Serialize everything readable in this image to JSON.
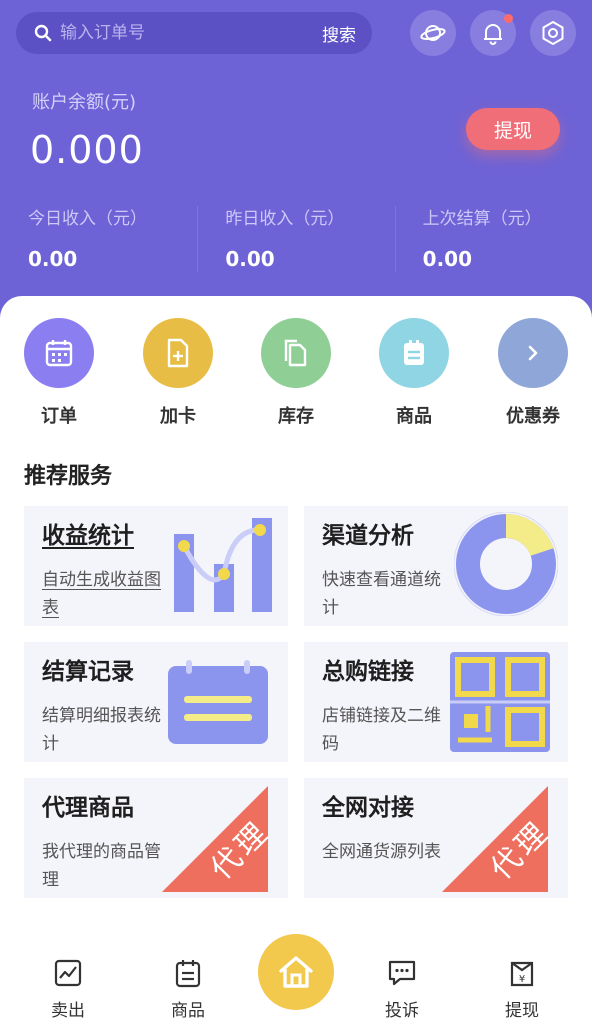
{
  "search": {
    "placeholder": "输入订单号",
    "button": "搜索"
  },
  "balance": {
    "label": "账户余额(元)",
    "value": "0.000",
    "withdraw": "提现"
  },
  "stats": [
    {
      "label": "今日收入（元）",
      "value": "0.00"
    },
    {
      "label": "昨日收入（元）",
      "value": "0.00"
    },
    {
      "label": "上次结算（元）",
      "value": "0.00"
    }
  ],
  "quick": [
    {
      "label": "订单",
      "color": "#8b7ef0",
      "icon": "calendar-icon"
    },
    {
      "label": "加卡",
      "color": "#e7bd45",
      "icon": "add-file-icon"
    },
    {
      "label": "库存",
      "color": "#8fcf96",
      "icon": "copy-icon"
    },
    {
      "label": "商品",
      "color": "#8fd5e3",
      "icon": "list-icon"
    },
    {
      "label": "优惠券",
      "color": "#8fa6d8",
      "icon": "chevron-right-icon"
    }
  ],
  "section": {
    "title": "推荐服务"
  },
  "tiles": [
    {
      "title": "收益统计",
      "desc": "自动生成收益图表",
      "art": "bar-chart-art"
    },
    {
      "title": "渠道分析",
      "desc": "快速查看通道统计",
      "art": "donut-chart-art"
    },
    {
      "title": "结算记录",
      "desc": "结算明细报表统计",
      "art": "calendar-art"
    },
    {
      "title": "总购链接",
      "desc": "店铺链接及二维码",
      "art": "qr-code-art"
    },
    {
      "title": "代理商品",
      "desc": "我代理的商品管理",
      "badge": "代理"
    },
    {
      "title": "全网对接",
      "desc": "全网通货源列表",
      "badge": "代理"
    }
  ],
  "nav": [
    {
      "label": "卖出",
      "icon": "chart-icon"
    },
    {
      "label": "商品",
      "icon": "clipboard-icon"
    },
    {
      "label": "投诉",
      "icon": "message-icon"
    },
    {
      "label": "提现",
      "icon": "wallet-icon"
    }
  ],
  "colors": {
    "primary": "#6d63d6",
    "accent": "#ef6e78",
    "home": "#f2c94c"
  }
}
